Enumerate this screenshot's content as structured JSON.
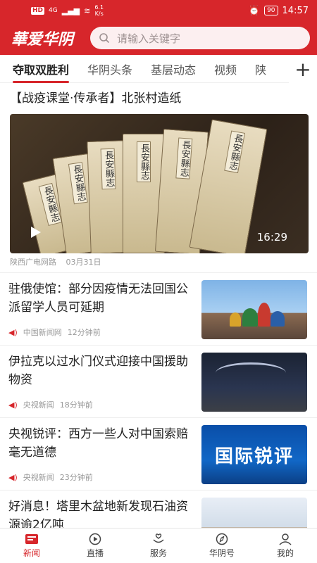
{
  "status": {
    "hd": "HD",
    "network": "4G",
    "speed_value": "6.1",
    "speed_unit": "K/s",
    "battery": "90",
    "time": "14:57"
  },
  "header": {
    "logo": "華爱华阴",
    "search_placeholder": "请输入关键字"
  },
  "tabs": [
    {
      "label": "夺取双胜利",
      "active": true
    },
    {
      "label": "华阴头条"
    },
    {
      "label": "基层动态"
    },
    {
      "label": "视频"
    },
    {
      "label": "陕"
    }
  ],
  "video_card": {
    "title": "【战疫课堂·传承者】北张村造纸",
    "duration": "16:29",
    "source": "陕西广电网路",
    "date": "03月31日",
    "book_labels": [
      "長安縣志",
      "長安縣志",
      "長安縣志",
      "長安縣志",
      "長安縣志",
      "長安縣志"
    ]
  },
  "news": [
    {
      "title": "驻俄使馆：部分因疫情无法回国公派留学人员可延期",
      "source": "中国新闻网",
      "time": "12分钟前"
    },
    {
      "title": "伊拉克以过水门仪式迎接中国援助物资",
      "source": "央视新闻",
      "time": "18分钟前"
    },
    {
      "title": "央视锐评：西方一些人对中国索赔毫无道德",
      "source": "央视新闻",
      "time": "23分钟前",
      "thumb_text": "国际锐评"
    },
    {
      "title": "好消息！塔里木盆地新发现石油资源逾2亿吨",
      "source": "",
      "time": ""
    }
  ],
  "bottom_nav": [
    {
      "label": "新闻",
      "icon": "news-icon",
      "active": true
    },
    {
      "label": "直播",
      "icon": "live-icon"
    },
    {
      "label": "服务",
      "icon": "service-icon"
    },
    {
      "label": "华阴号",
      "icon": "compass-icon"
    },
    {
      "label": "我的",
      "icon": "user-icon"
    }
  ],
  "colors": {
    "brand": "#d7262b",
    "text": "#222222",
    "muted": "#999999"
  }
}
